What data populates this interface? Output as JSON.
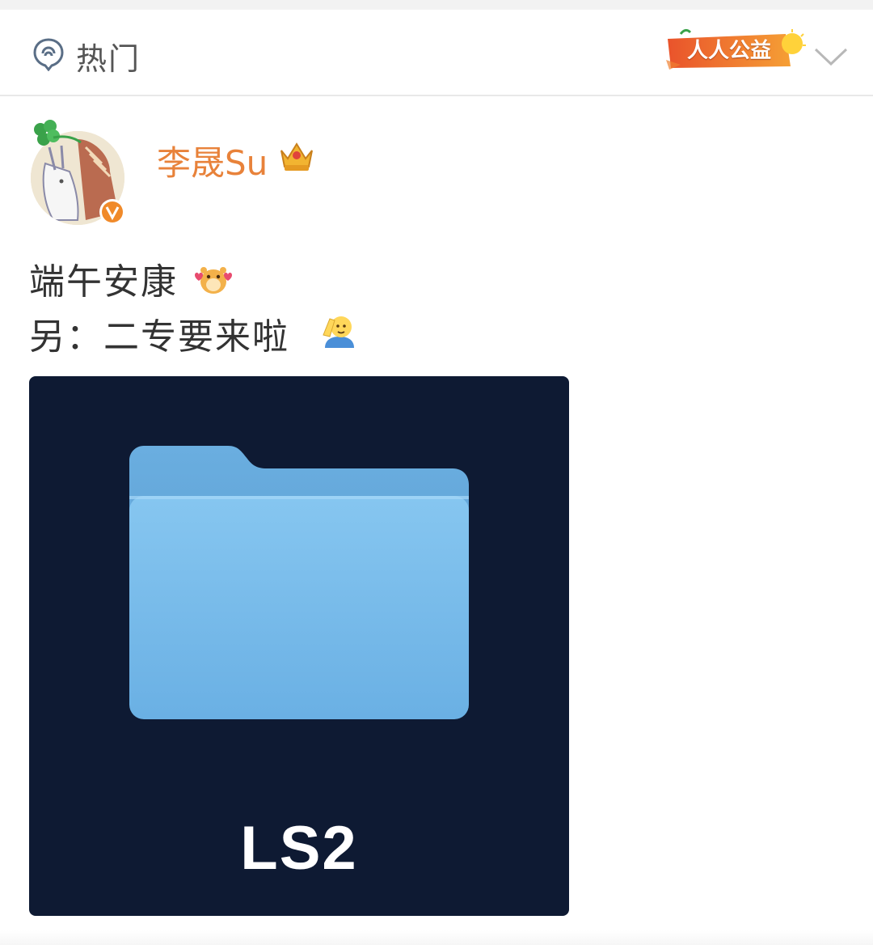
{
  "header": {
    "tab_label": "热门",
    "charity_badge": "人人公益",
    "icons": [
      "hot-location-icon",
      "charity-badge-icon",
      "chevron-down-icon"
    ]
  },
  "post": {
    "author": "李晟Su",
    "author_color": "#e8823a",
    "badge_icons": [
      "verified-v-icon",
      "crown-membership-icon"
    ],
    "text_line1": "端午安康",
    "text_line2": "另：二专要来啦",
    "emoji_icons": [
      "hamster-love-icon",
      "salute-icon"
    ],
    "image": {
      "icon": "folder-icon",
      "caption": "LS2",
      "background": "#0e1a33"
    }
  }
}
